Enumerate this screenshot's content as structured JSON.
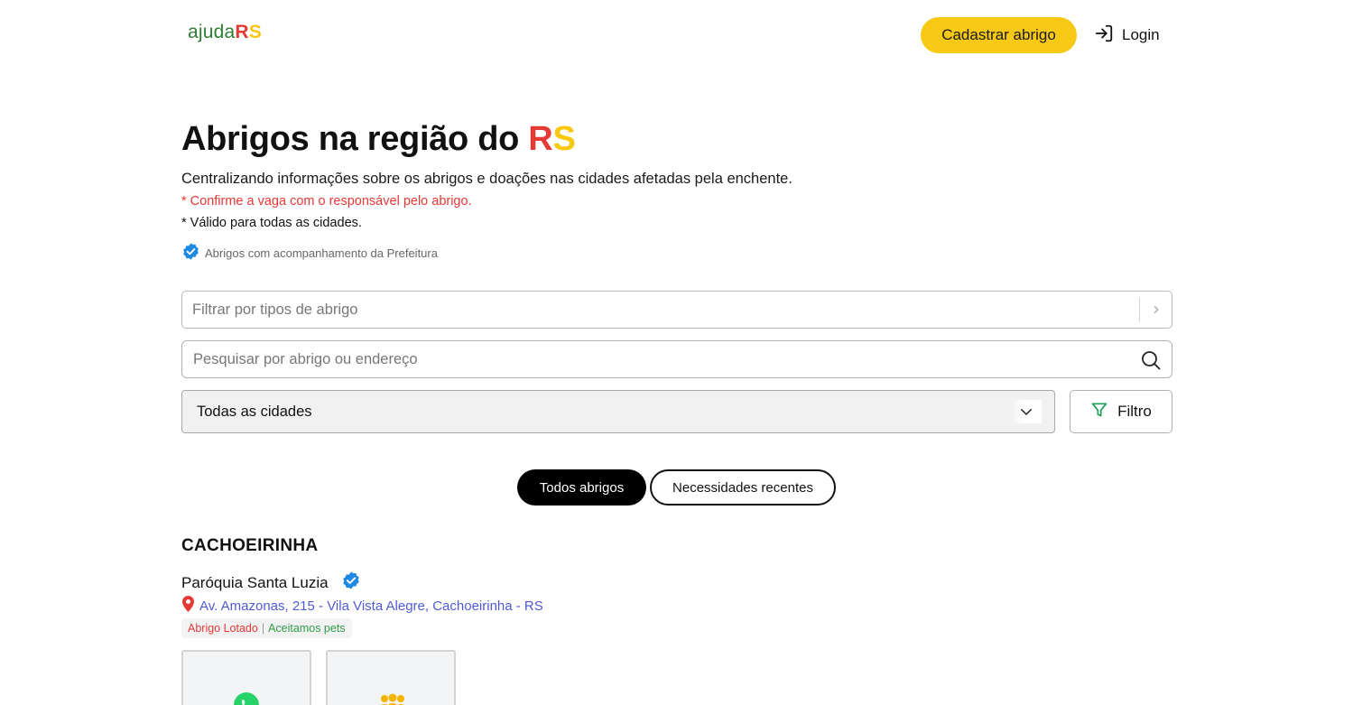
{
  "header": {
    "logo": {
      "word": "ajuda",
      "r": "R",
      "s": "S"
    },
    "register_button": "Cadastrar abrigo",
    "login_button": "Login"
  },
  "hero": {
    "title_prefix": "Abrigos na região do ",
    "title_r": "R",
    "title_s": "S",
    "subtitle": "Centralizando informações sobre os abrigos e doações nas cidades afetadas pela enchente.",
    "note_confirm": "* Confirme a vaga com o responsável pelo abrigo.",
    "note_valid": "* Válido para todas as cidades.",
    "verified_note": "Abrigos com acompanhamento da Prefeitura"
  },
  "filters": {
    "type_placeholder": "Filtrar por tipos de abrigo",
    "search_placeholder": "Pesquisar por abrigo ou endereço",
    "city_selected": "Todas as cidades",
    "filter_button": "Filtro"
  },
  "tabs": [
    {
      "label": "Todos abrigos",
      "active": true
    },
    {
      "label": "Necessidades recentes",
      "active": false
    }
  ],
  "listing": {
    "city": "CACHOEIRINHA",
    "shelter": {
      "name": "Paróquia Santa Luzia",
      "verified": true,
      "address": "Av. Amazonas, 215 - Vila Vista Alegre, Cachoeirinha - RS",
      "tag_status": "Abrigo Lotado",
      "tag_separator": "|",
      "tag_pets": "Aceitamos pets",
      "cards": [
        {
          "icon": "whatsapp-icon"
        },
        {
          "icon": "people-icon"
        }
      ]
    }
  },
  "colors": {
    "accent_yellow": "#f8c914",
    "rs_red": "#e53935",
    "rs_yellow": "#f9c80e",
    "logo_green": "#2e7d32",
    "verified_blue": "#1e88e5",
    "link_blue": "#4f5bd5",
    "pets_green": "#2e9e46",
    "filter_icon_green": "#1f9d55"
  }
}
